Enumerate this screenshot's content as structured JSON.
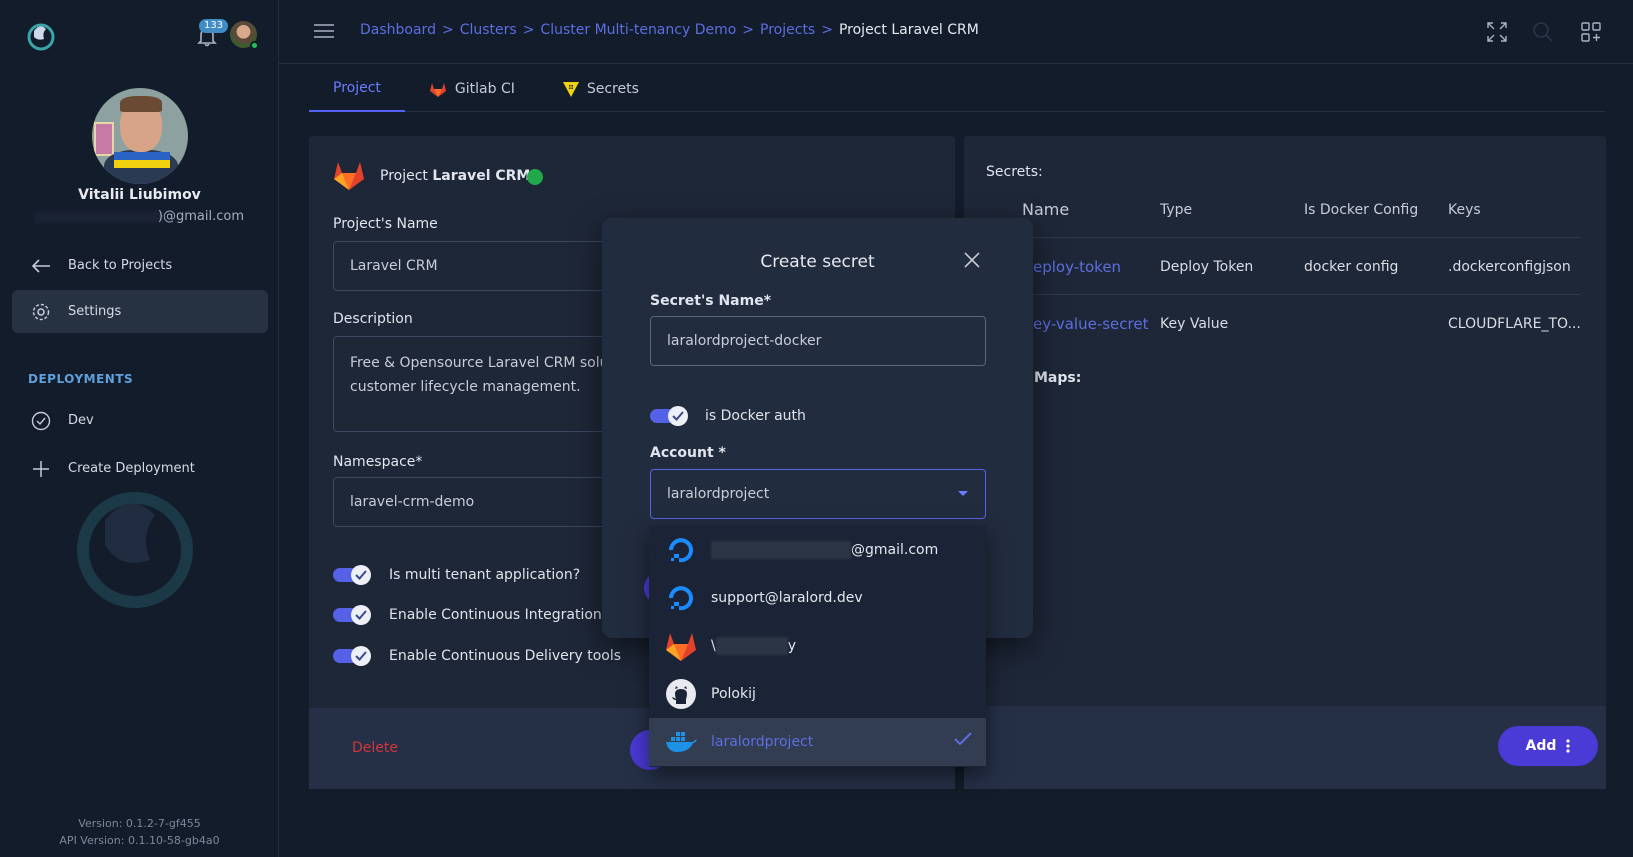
{
  "sidebar": {
    "notification_count": "133",
    "user_name": "Vitalii Liubimov",
    "user_email_visible": ")@gmail.com",
    "back_label": "Back to Projects",
    "settings_label": "Settings",
    "section_title": "DEPLOYMENTS",
    "deployments": [
      {
        "label": "Dev"
      },
      {
        "label": "Create Deployment"
      }
    ],
    "version": "Version: 0.1.2-7-gf455",
    "api_version": "API Version: 0.1.10-58-gb4a0"
  },
  "breadcrumb": {
    "items": [
      "Dashboard",
      "Clusters",
      "Cluster Multi-tenancy Demo",
      "Projects"
    ],
    "separator": ">",
    "current": "Project Laravel CRM"
  },
  "tabs": [
    {
      "label": "Project",
      "icon": "none"
    },
    {
      "label": "Gitlab CI",
      "icon": "gitlab-icon"
    },
    {
      "label": "Secrets",
      "icon": "vault-icon"
    }
  ],
  "project": {
    "header_prefix": "Project",
    "header_name": "Laravel CRM",
    "name_label": "Project's Name",
    "name_value": "Laravel CRM",
    "description_label": "Description",
    "description_value": "Free & Opensource Laravel CRM solut\ncustomer lifecycle management.",
    "namespace_label": "Namespace*",
    "namespace_value": "laravel-crm-demo",
    "toggles": [
      {
        "label": "Is multi tenant application?",
        "on": true
      },
      {
        "label": "Enable Continuous Integration to",
        "on": true
      },
      {
        "label": "Enable Continuous Delivery tools",
        "on": true
      }
    ],
    "delete_label": "Delete"
  },
  "secrets": {
    "title": "Secrets:",
    "columns": [
      "Name",
      "Type",
      "Is Docker Config",
      "Keys"
    ],
    "rows": [
      {
        "name": "eploy-token",
        "type": "Deploy Token",
        "docker": "docker config",
        "keys": ".dockerconfigjson"
      },
      {
        "name": "ey-value-secret",
        "type": "Key Value",
        "docker": "",
        "keys": "CLOUDFLARE_TO..."
      }
    ],
    "config_maps_label": "Maps:",
    "add_label": "Add",
    "add_icon": "kebab-icon"
  },
  "modal": {
    "title": "Create secret",
    "secret_name_label": "Secret's Name*",
    "secret_name_value": "laralordproject-docker",
    "docker_toggle_label": "is Docker auth",
    "docker_toggle_on": true,
    "account_label": "Account *",
    "account_value": "laralordproject",
    "options": [
      {
        "label": "@gmail.com",
        "icon": "digitalocean-icon",
        "selected": false
      },
      {
        "label": "support@laralord.dev",
        "icon": "digitalocean-icon",
        "selected": false
      },
      {
        "label_start": "\\",
        "label_end": "y",
        "icon": "gitlab-icon",
        "selected": false
      },
      {
        "label": "Polokij",
        "icon": "github-icon",
        "selected": false
      },
      {
        "label": "laralordproject",
        "icon": "docker-icon",
        "selected": true
      }
    ]
  },
  "colors": {
    "background": "#131c2b",
    "panel": "#1e2738",
    "accent": "#5463f5",
    "link": "#5c6ee0",
    "danger": "#d2343c",
    "online": "#20c35a"
  }
}
